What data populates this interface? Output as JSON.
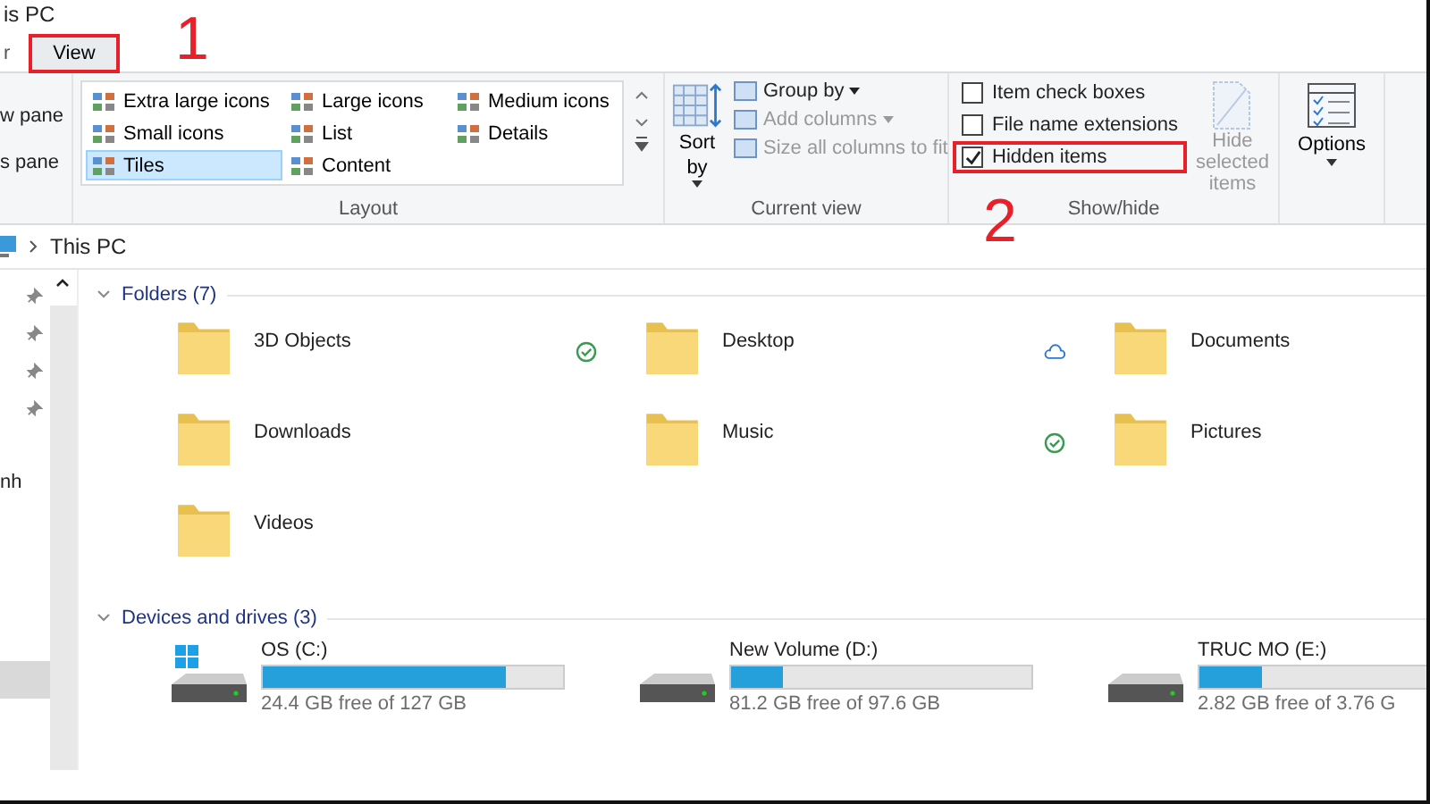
{
  "window": {
    "title": "is PC"
  },
  "ribbon_tabs": [
    {
      "label": "r",
      "selected": false,
      "highlighted": false
    },
    {
      "label": "View",
      "selected": true,
      "highlighted": true
    }
  ],
  "ribbon": {
    "panes": [
      "w pane",
      "s pane"
    ],
    "layout": {
      "label": "Layout",
      "options": [
        {
          "label": "Extra large icons",
          "selected": false
        },
        {
          "label": "Large icons",
          "selected": false
        },
        {
          "label": "Medium icons",
          "selected": false
        },
        {
          "label": "Small icons",
          "selected": false
        },
        {
          "label": "List",
          "selected": false
        },
        {
          "label": "Details",
          "selected": false
        },
        {
          "label": "Tiles",
          "selected": true
        },
        {
          "label": "Content",
          "selected": false
        }
      ]
    },
    "current_view": {
      "label": "Current view",
      "sort_by": "Sort by",
      "items": [
        {
          "label": "Group by",
          "disabled": false,
          "dropdown": true
        },
        {
          "label": "Add columns",
          "disabled": true,
          "dropdown": true
        },
        {
          "label": "Size all columns to fit",
          "disabled": true,
          "dropdown": false
        }
      ]
    },
    "show_hide": {
      "label": "Show/hide",
      "checkboxes": [
        {
          "label": "Item check boxes",
          "checked": false,
          "highlighted": false
        },
        {
          "label": "File name extensions",
          "checked": false,
          "highlighted": false
        },
        {
          "label": "Hidden items",
          "checked": true,
          "highlighted": true
        }
      ],
      "hide_selected": {
        "label": "Hide selected items",
        "disabled": true
      }
    },
    "options": {
      "label": "Options"
    }
  },
  "address": {
    "path": [
      "This PC"
    ]
  },
  "nav_pane": {
    "items": [
      {
        "kind": "pinned",
        "selected": false
      },
      {
        "kind": "pinned",
        "selected": false
      },
      {
        "kind": "pinned",
        "selected": false
      },
      {
        "kind": "pinned",
        "selected": false
      },
      {
        "kind": "text",
        "label": "nh",
        "selected": false
      },
      {
        "kind": "blank",
        "selected": true
      }
    ]
  },
  "sections": [
    {
      "kind": "folders",
      "title": "Folders (7)",
      "expanded": true,
      "items": [
        {
          "name": "3D Objects",
          "synced": true,
          "cloud_only": false
        },
        {
          "name": "Desktop",
          "synced": false,
          "cloud_only": true
        },
        {
          "name": "Documents",
          "synced": false,
          "cloud_only": false
        },
        {
          "name": "Downloads",
          "synced": false,
          "cloud_only": false
        },
        {
          "name": "Music",
          "synced": true,
          "cloud_only": false
        },
        {
          "name": "Pictures",
          "synced": false,
          "cloud_only": false
        },
        {
          "name": "Videos",
          "synced": false,
          "cloud_only": false
        }
      ]
    },
    {
      "kind": "drives",
      "title": "Devices and drives (3)",
      "expanded": true,
      "items": [
        {
          "name": "OS (C:)",
          "system": true,
          "level": 0.81,
          "free": "24.4 GB free of 127 GB"
        },
        {
          "name": "New Volume (D:)",
          "system": false,
          "level": 0.17,
          "free": "81.2 GB free of 97.6 GB"
        },
        {
          "name": "TRUC MO (E:)",
          "system": false,
          "level": 0.25,
          "free": "2.82 GB free of 3.76 G"
        }
      ]
    }
  ],
  "annotations": [
    {
      "label": "1"
    },
    {
      "label": "2"
    }
  ]
}
